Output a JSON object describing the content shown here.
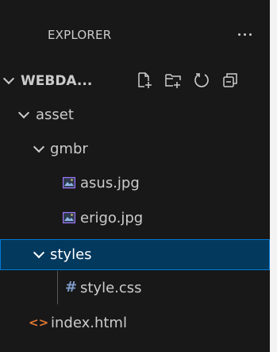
{
  "explorer": {
    "title": "EXPLORER",
    "more_icon": "ellipsis-icon"
  },
  "project": {
    "name": "WEBDA...",
    "actions": [
      "new-file-icon",
      "new-folder-icon",
      "refresh-icon",
      "collapse-all-icon"
    ]
  },
  "tree": [
    {
      "label": "asset",
      "type": "folder",
      "expanded": true,
      "selected": false
    },
    {
      "label": "gmbr",
      "type": "folder",
      "expanded": true,
      "selected": false
    },
    {
      "label": "asus.jpg",
      "type": "image",
      "icon": "image-file-icon"
    },
    {
      "label": "erigo.jpg",
      "type": "image",
      "icon": "image-file-icon"
    },
    {
      "label": "styles",
      "type": "folder",
      "expanded": true,
      "selected": true
    },
    {
      "label": "style.css",
      "type": "css",
      "icon": "hash-icon"
    },
    {
      "label": "index.html",
      "type": "html",
      "icon": "html-brackets-icon"
    }
  ],
  "colors": {
    "background": "#181818",
    "selection": "#04395e",
    "selection_border": "#0078d4",
    "html_icon": "#e37933",
    "css_icon": "#7f9ccb"
  }
}
